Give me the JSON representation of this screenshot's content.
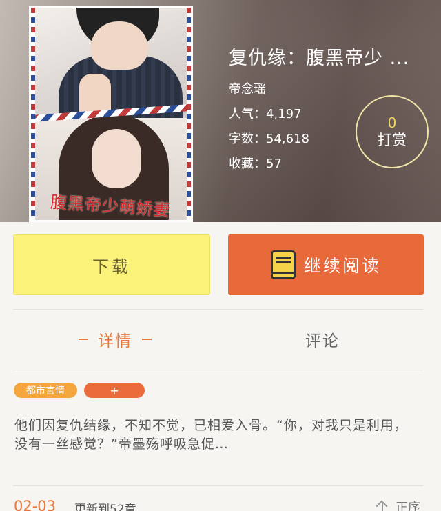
{
  "book": {
    "title": "复仇缘：腹黑帝少 ...",
    "author": "帝念瑶",
    "popularity_label": "人气：",
    "popularity": "4,197",
    "word_count_label": "字数：",
    "word_count": "54,618",
    "favorites_label": "收藏：",
    "favorites": "57",
    "cover_text": "腹黑帝少萌娇妻"
  },
  "reward": {
    "count": "0",
    "label": "打赏"
  },
  "actions": {
    "download": "下载",
    "continue_reading": "继续阅读"
  },
  "tabs": {
    "detail": "详情",
    "comments": "评论"
  },
  "tags": {
    "genre": "都市言情",
    "add": "+"
  },
  "description": "他们因复仇结缘，不知不觉，已相爱入骨。“你，对我只是利用，没有一丝感觉？”帝墨殇呼吸急促…",
  "footer": {
    "date": "02-03",
    "update_text": "更新到52章",
    "sort_label": "正序"
  },
  "colors": {
    "accent": "#e8693a",
    "download_bg": "#fbf27a",
    "tag_genre": "#f4a53c",
    "reward_count": "#f2d659"
  },
  "icons": {
    "read": "book-icon",
    "sort": "arrow-up-icon"
  }
}
